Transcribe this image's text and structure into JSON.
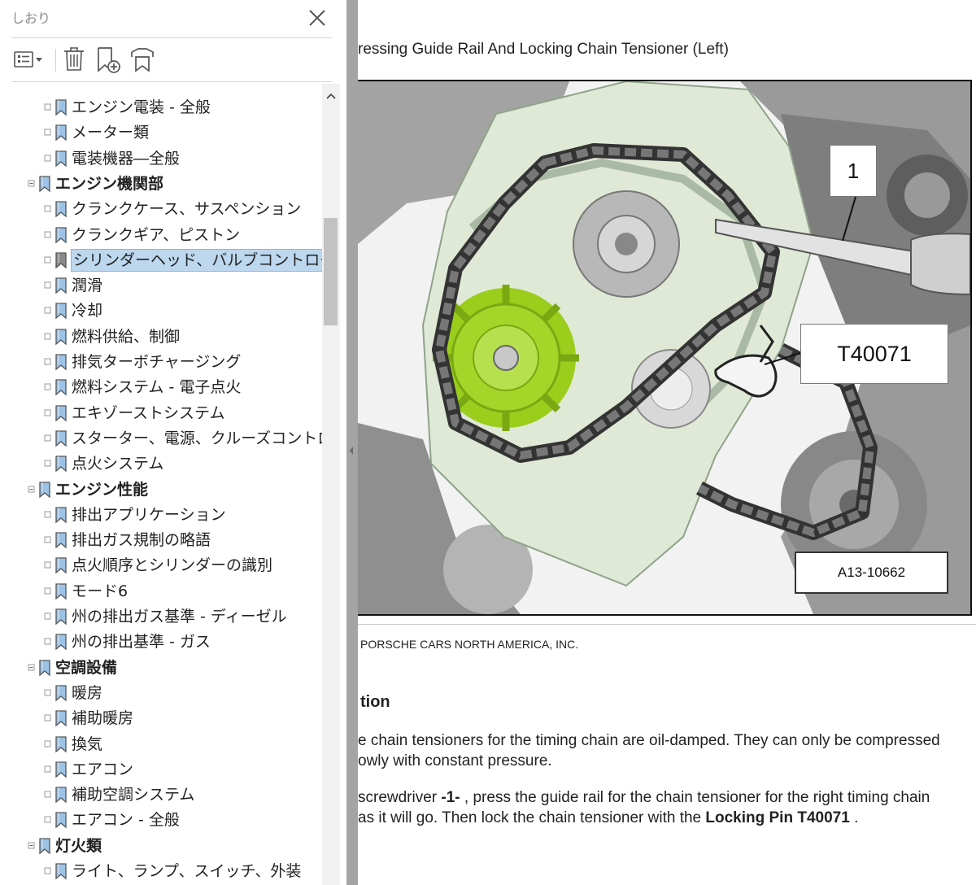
{
  "sidebar": {
    "title": "しおり",
    "close_icon": "close-icon",
    "toolbar": [
      {
        "name": "options-menu-icon"
      },
      {
        "name": "delete-bookmark-icon"
      },
      {
        "name": "new-bookmark-icon"
      },
      {
        "name": "expand-bookmark-icon"
      }
    ],
    "tree": [
      {
        "label": "エンジン電装 - 全般",
        "level": 2
      },
      {
        "label": "メーター類",
        "level": 2
      },
      {
        "label": "電装機器―全般",
        "level": 2
      },
      {
        "label": "エンジン機関部",
        "level": 1
      },
      {
        "label": "クランクケース、サスペンション",
        "level": 2
      },
      {
        "label": "クランクギア、ピストン",
        "level": 2
      },
      {
        "label": "シリンダーヘッド、バルブコントロール",
        "level": 2,
        "selected": true
      },
      {
        "label": "潤滑",
        "level": 2
      },
      {
        "label": "冷却",
        "level": 2
      },
      {
        "label": "燃料供給、制御",
        "level": 2
      },
      {
        "label": "排気ターボチャージング",
        "level": 2
      },
      {
        "label": "燃料システム - 電子点火",
        "level": 2
      },
      {
        "label": "エキゾーストシステム",
        "level": 2
      },
      {
        "label": "スターター、電源、クルーズコントロール",
        "level": 2
      },
      {
        "label": "点火システム",
        "level": 2
      },
      {
        "label": "エンジン性能",
        "level": 1
      },
      {
        "label": "排出アプリケーション",
        "level": 2
      },
      {
        "label": "排出ガス規制の略語",
        "level": 2
      },
      {
        "label": "点火順序とシリンダーの識別",
        "level": 2
      },
      {
        "label": "モード6",
        "level": 2
      },
      {
        "label": "州の排出ガス基準 - ディーゼル",
        "level": 2
      },
      {
        "label": "州の排出基準 - ガス",
        "level": 2
      },
      {
        "label": "空調設備",
        "level": 1
      },
      {
        "label": "暖房",
        "level": 2
      },
      {
        "label": "補助暖房",
        "level": 2
      },
      {
        "label": "換気",
        "level": 2
      },
      {
        "label": "エアコン",
        "level": 2
      },
      {
        "label": "補助空調システム",
        "level": 2
      },
      {
        "label": "エアコン - 全般",
        "level": 2
      },
      {
        "label": "灯火類",
        "level": 1
      },
      {
        "label": "ライト、ランプ、スイッチ、外装",
        "level": 2
      }
    ]
  },
  "document": {
    "title": "ressing Guide Rail And Locking Chain Tensioner (Left)",
    "figure": {
      "callout_1": "1",
      "callout_tool": "T40071",
      "figure_id": "A13-10662"
    },
    "copyright": "PORSCHE CARS NORTH AMERICA, INC.",
    "section_heading": "tion",
    "paragraph1_line1": "e chain tensioners for the timing chain are oil-damped. They can only be compressed",
    "paragraph1_line2": "owly with constant pressure.",
    "paragraph2_line1_pre": "screwdriver ",
    "paragraph2_line1_bold": "-1-",
    "paragraph2_line1_post": " , press the guide rail for the chain tensioner for the right timing chain",
    "paragraph2_line2_pre": " as it will go. Then lock the chain tensioner with the ",
    "paragraph2_line2_bold": "Locking Pin T40071",
    "paragraph2_line2_post": " ."
  },
  "colors": {
    "selection": "#bcd7ee",
    "splitter": "#a4a4a4",
    "sprocket_green": "#9acd1c",
    "engine_green": "#dfe9d6"
  }
}
